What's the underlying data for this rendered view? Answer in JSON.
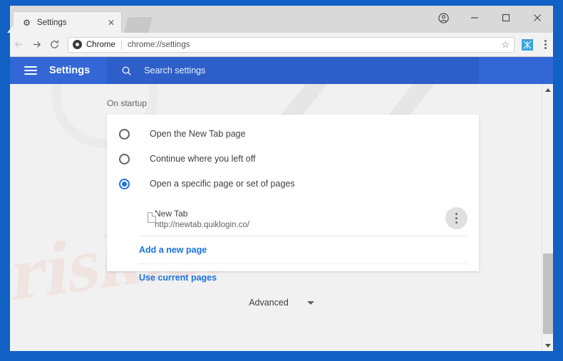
{
  "window": {
    "frame_color": "#1160c4",
    "controls": [
      {
        "name": "profile",
        "glyph": "Θ"
      },
      {
        "name": "minimize",
        "glyph": "–"
      },
      {
        "name": "maximize",
        "glyph": "□"
      },
      {
        "name": "close",
        "glyph": "✕"
      }
    ]
  },
  "tab": {
    "title": "Settings",
    "favicon": "⚙",
    "close_glyph": "✕"
  },
  "toolbar": {
    "back_glyph": "←",
    "forward_glyph": "→",
    "reload_glyph": "⟳",
    "chrome_label": "Chrome",
    "url": "chrome://settings",
    "star_glyph": "☆",
    "extension_glyph": "⌘"
  },
  "settings_header": {
    "title": "Settings",
    "search_placeholder": "Search settings",
    "bg_color": "#3367d6",
    "search_bg_color": "#2e5fc9"
  },
  "main": {
    "section_label": "On startup",
    "startup_options": [
      {
        "label": "Open the New Tab page",
        "selected": false
      },
      {
        "label": "Continue where you left off",
        "selected": false
      },
      {
        "label": "Open a specific page or set of pages",
        "selected": true
      }
    ],
    "startup_page": {
      "title": "New Tab",
      "url": "http://newtab.quiklogin.co/"
    },
    "links": [
      {
        "label": "Add a new page"
      },
      {
        "label": "Use current pages"
      }
    ],
    "advanced_label": "Advanced",
    "accent_color": "#1a73e8"
  },
  "watermark": {
    "text": "risk.com",
    "glyph": "╱╱"
  }
}
